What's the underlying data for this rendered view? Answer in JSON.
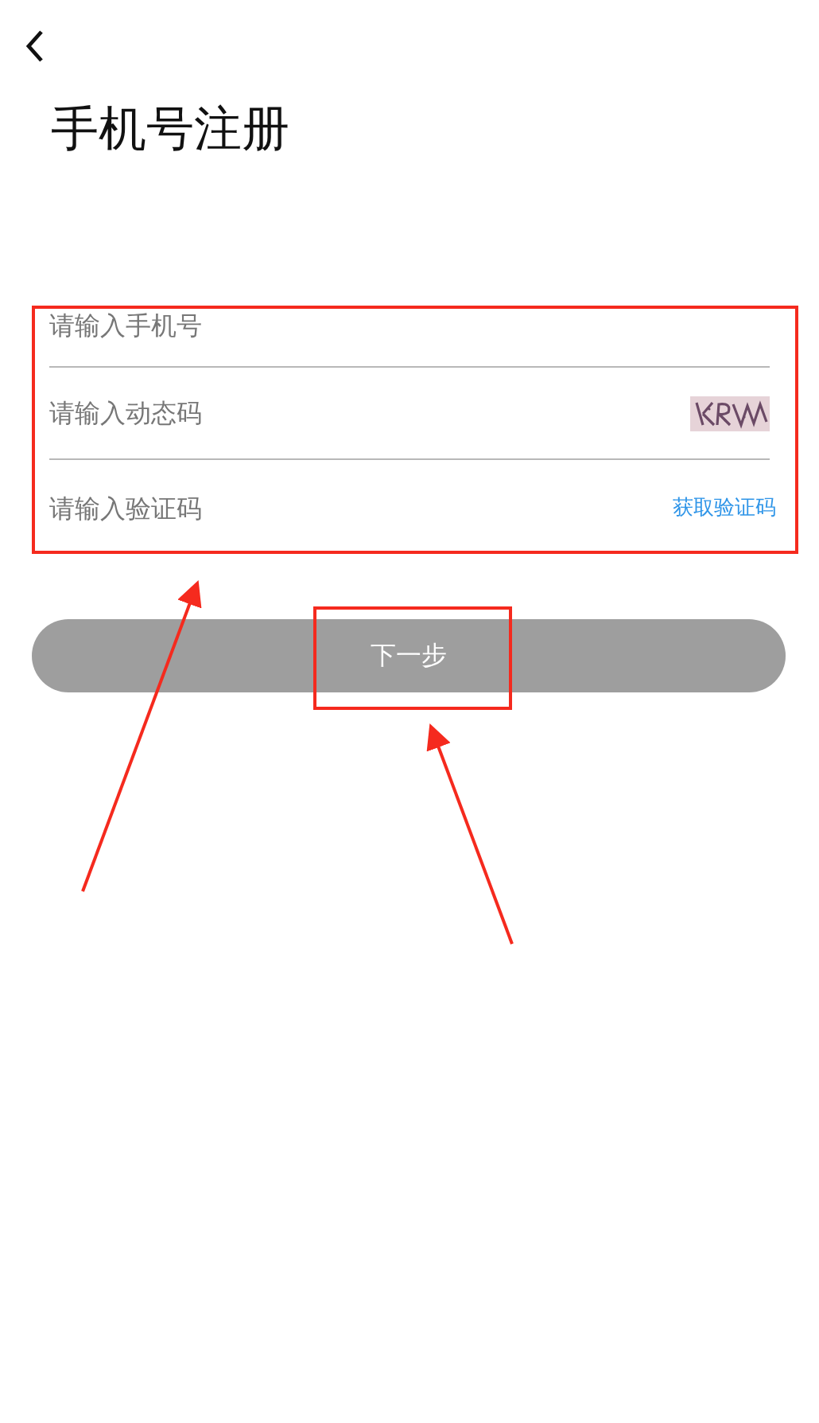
{
  "title": "手机号注册",
  "fields": [
    {
      "kind": "plain",
      "placeholder": "请输入手机号"
    },
    {
      "kind": "captcha",
      "placeholder": "请输入动态码"
    },
    {
      "kind": "sms",
      "placeholder": "请输入验证码",
      "action": "获取验证码"
    }
  ],
  "next_button": "下一步"
}
